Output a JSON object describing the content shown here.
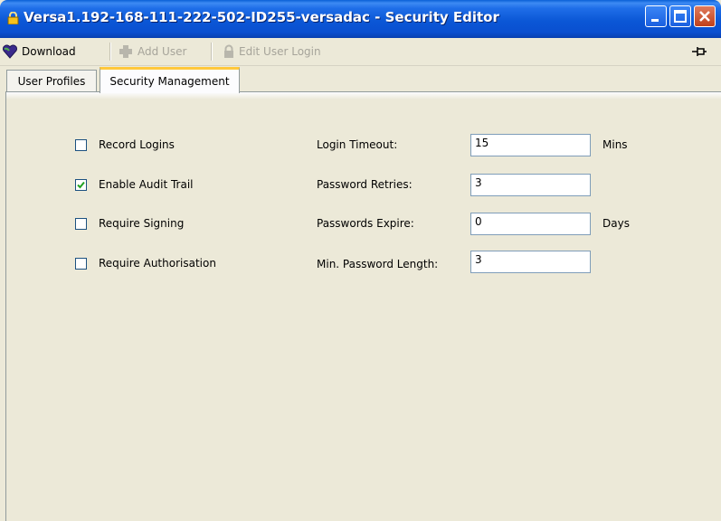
{
  "window": {
    "title": "Versa1.192-168-111-222-502-ID255-versadac - Security Editor",
    "controls": [
      "minimize",
      "maximize",
      "close"
    ]
  },
  "toolbar": {
    "download_label": "Download",
    "add_user_label": "Add User",
    "edit_user_login_label": "Edit User Login"
  },
  "tabs": [
    {
      "label": "User Profiles",
      "active": false
    },
    {
      "label": "Security Management",
      "active": true
    }
  ],
  "options": [
    {
      "label": "Record Logins",
      "checked": false
    },
    {
      "label": "Enable Audit Trail",
      "checked": true
    },
    {
      "label": "Require Signing",
      "checked": false
    },
    {
      "label": "Require Authorisation",
      "checked": false
    }
  ],
  "fields": [
    {
      "label": "Login Timeout:",
      "value": "15",
      "unit": "Mins"
    },
    {
      "label": "Password Retries:",
      "value": "3",
      "unit": ""
    },
    {
      "label": "Passwords Expire:",
      "value": "0",
      "unit": "Days"
    },
    {
      "label": "Min. Password Length:",
      "value": "3",
      "unit": ""
    }
  ],
  "colors": {
    "titlebar": "#0b57d6",
    "panel_bg": "#ece9d8",
    "active_tab_accent": "#ffc83c",
    "check_mark": "#21a121"
  }
}
